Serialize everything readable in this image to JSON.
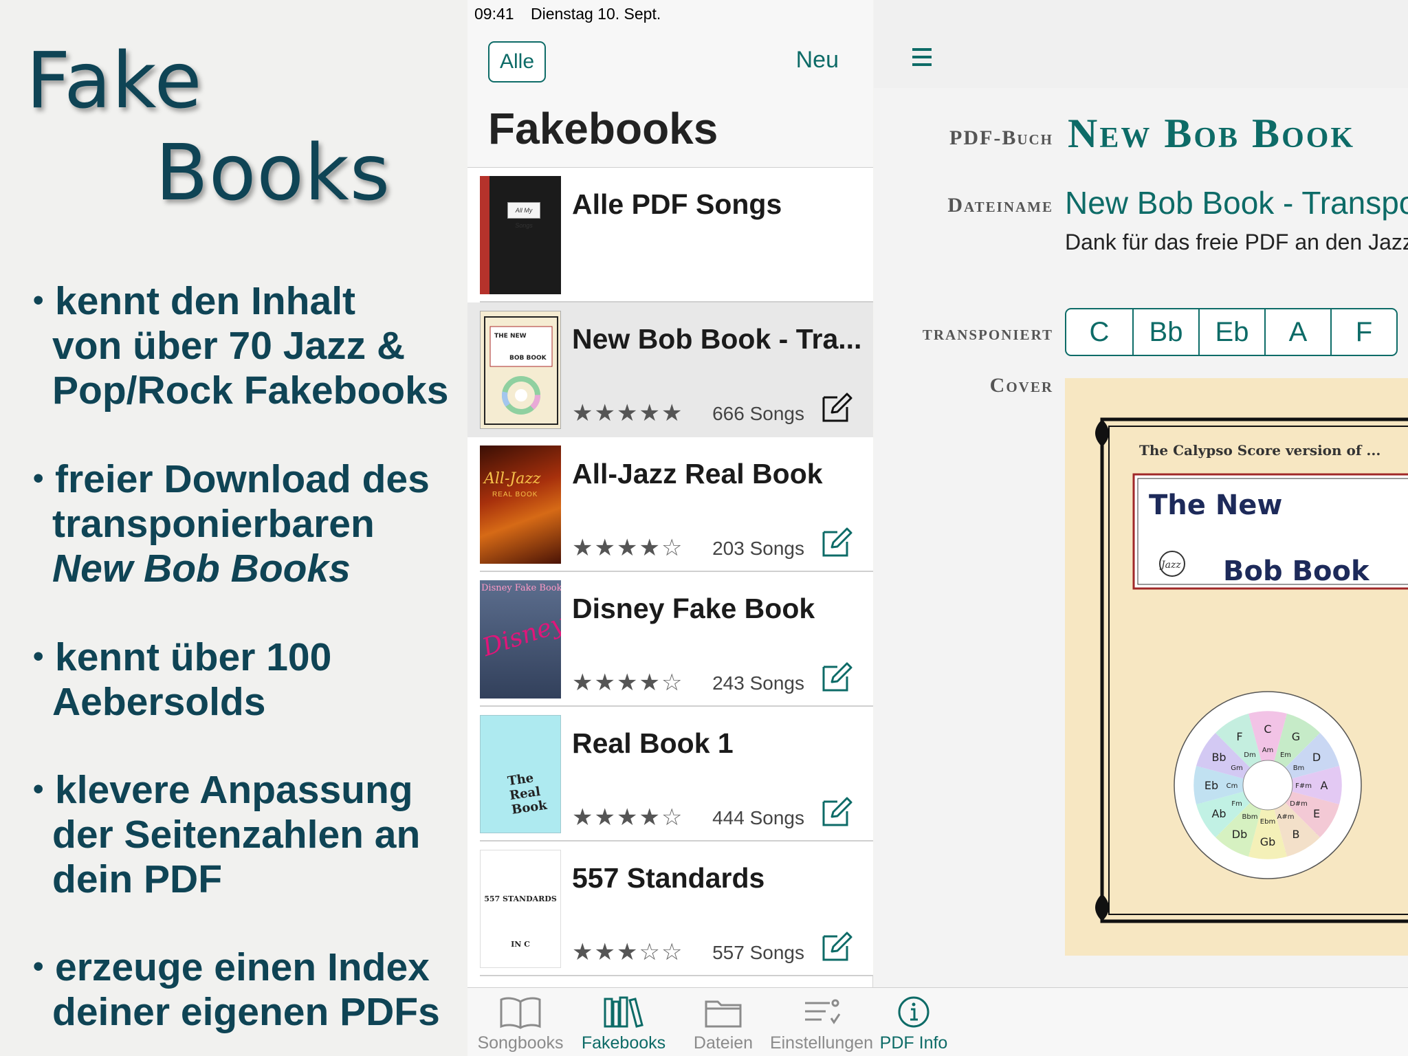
{
  "promo": {
    "title_line1": "Fake",
    "title_line2": "Books",
    "bullets": [
      {
        "lines": [
          "kennt den Inhalt",
          "von über 70 Jazz &",
          "Pop/Rock Fakebooks"
        ]
      },
      {
        "lines": [
          "freier Download des",
          "transponierbaren"
        ],
        "italic_line": "New Bob Books"
      },
      {
        "lines": [
          "kennt über 100",
          "Aebersolds"
        ]
      },
      {
        "lines": [
          "klevere Anpassung",
          "der Seitenzahlen an",
          "dein PDF"
        ]
      },
      {
        "lines": [
          "erzeuge einen Index",
          "deiner eigenen PDFs"
        ]
      }
    ],
    "bullet_char": "•"
  },
  "status": {
    "time": "09:41",
    "date": "Dienstag 10. Sept."
  },
  "list": {
    "all_button": "Alle",
    "new_button": "Neu",
    "title": "Fakebooks",
    "rows": [
      {
        "title": "Alle PDF Songs",
        "cover": "black",
        "cover_text": "All My Songs"
      },
      {
        "title": "New Bob Book - Tra...",
        "rating": 5,
        "count": "666 Songs",
        "cover": "cream",
        "selected": true
      },
      {
        "title": "All-Jazz Real Book",
        "rating": 4,
        "count": "203 Songs",
        "cover": "jazz",
        "cover_text": "All-Jazz",
        "cover_sub": "REAL BOOK"
      },
      {
        "title": "Disney Fake Book",
        "rating": 4,
        "count": "243 Songs",
        "cover": "disney",
        "cover_text": "Disney Fake Book",
        "cover_sub": "Disney"
      },
      {
        "title": "Real Book 1",
        "rating": 4,
        "count": "444 Songs",
        "cover": "cyan",
        "cover_text": "The Real Book"
      },
      {
        "title": "557 Standards",
        "rating": 3,
        "count": "557 Songs",
        "cover": "white",
        "cover_text": "557 STANDARDS",
        "cover_sub": "IN C"
      }
    ]
  },
  "tabs": [
    {
      "label": "Songbooks",
      "icon": "book-open-icon"
    },
    {
      "label": "Fakebooks",
      "icon": "books-shelf-icon",
      "active": true
    },
    {
      "label": "Dateien",
      "icon": "folder-icon"
    },
    {
      "label": "Einstellungen",
      "icon": "settings-list-icon"
    },
    {
      "label": "PDF Info",
      "icon": "info-circle-icon"
    }
  ],
  "detail": {
    "label_pdf_book": "PDF-Buch",
    "label_filename": "Dateiname",
    "label_transposed": "transponiert",
    "label_cover": "Cover",
    "book_title": "New Bob Book",
    "file_name": "New Bob Book - Transpos",
    "thanks": "Dank für das freie PDF an den Jazz",
    "keys": [
      "C",
      "Bb",
      "Eb",
      "A",
      "F"
    ],
    "cover": {
      "header": "The Calypso Score version of ...",
      "title_top": "The New",
      "title_bottom": "Bob Book",
      "badge": "Jazz",
      "circle_outer": [
        "C",
        "G",
        "D",
        "A",
        "E",
        "B",
        "Gb",
        "Db",
        "Ab",
        "Eb",
        "Bb",
        "F"
      ],
      "circle_inner": [
        "Am",
        "Em",
        "Bm",
        "F#m",
        "D#m",
        "A#m",
        "Ebm",
        "Bbm",
        "Fm",
        "Cm",
        "Gm",
        "Dm"
      ]
    }
  },
  "colors": {
    "accent": "#0d6b67",
    "promo_text": "#0f4455"
  }
}
